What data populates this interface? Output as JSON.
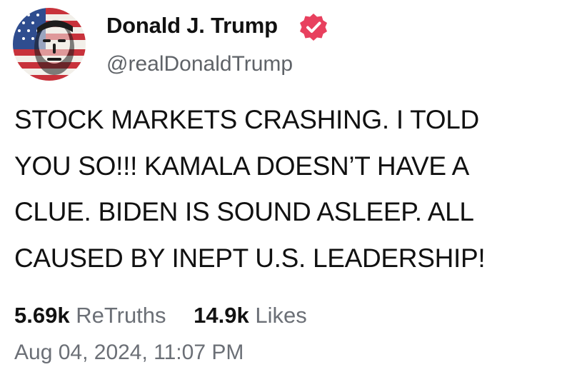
{
  "author": {
    "display_name": "Donald J. Trump",
    "handle": "@realDonaldTrump",
    "verified": true,
    "avatar_icon": "flag-portrait-avatar",
    "verified_color": "#e8405e"
  },
  "post": {
    "text": "STOCK MARKETS CRASHING. I TOLD\nYOU SO!!! KAMALA DOESN’T HAVE A\nCLUE. BIDEN IS SOUND ASLEEP. ALL\nCAUSED BY INEPT U.S. LEADERSHIP!",
    "retruths_count": "5.69k",
    "retruths_label": "ReTruths",
    "likes_count": "14.9k",
    "likes_label": "Likes",
    "timestamp": "Aug 04, 2024, 11:07 PM"
  }
}
